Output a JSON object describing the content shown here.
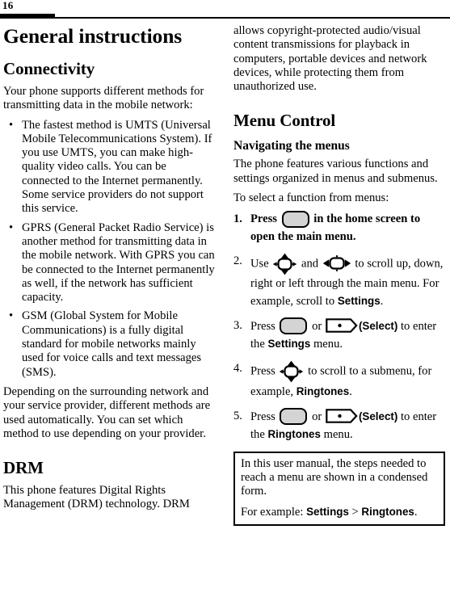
{
  "page": {
    "folio": "16"
  },
  "left_column": {
    "chapter_title": "General instructions",
    "connectivity": {
      "heading": "Connectivity",
      "intro": "Your phone supports different methods for transmitting data in the mobile network:",
      "bullets": [
        "The fastest method is UMTS (Universal Mobile Telecommunications System). If you use UMTS, you can make high-quality video calls. You can be connected to the Internet permanently. Some service providers do not support this service.",
        "GPRS (General Packet Radio Service) is another method for transmitting data in the mobile network. With GPRS you can be connected to the Internet permanently as well, if the network has sufficient capacity.",
        "GSM (Global System for Mobile Communications) is a fully digital standard for mobile networks mainly used for voice calls and text messages (SMS)."
      ],
      "closing": "Depending on the surrounding network and your service provider, different methods are used automatically. You can set which method to use depending on your provider."
    },
    "drm": {
      "heading": "DRM",
      "paragraph": "This phone features Digital Rights Management (DRM) technology. DRM"
    }
  },
  "right_column": {
    "drm_continued": "allows copyright-protected audio/visual content transmissions for playback in computers, portable devices and network devices, while protecting them from unauthorized use.",
    "menu_control": {
      "heading": "Menu Control",
      "subheading": "Navigating the menus",
      "paragraph1": "The phone features various functions and settings organized in menus and submenus.",
      "paragraph2": "To select a function from menus:",
      "steps": [
        {
          "number": "1.",
          "bold": true,
          "parts": [
            {
              "type": "text",
              "value": "Press "
            },
            {
              "type": "icon",
              "icon": "menu-key-icon"
            },
            {
              "type": "text",
              "value": " in the home screen to open the main menu."
            }
          ]
        },
        {
          "number": "2.",
          "bold": false,
          "parts": [
            {
              "type": "text",
              "value": "Use "
            },
            {
              "type": "icon",
              "icon": "nav-key-vertical-icon"
            },
            {
              "type": "text",
              "value": " and "
            },
            {
              "type": "icon",
              "icon": "nav-key-horizontal-icon"
            },
            {
              "type": "text",
              "value": "  to scroll up, down, right or left through the main menu. For example, scroll to "
            },
            {
              "type": "ui",
              "value": "Settings"
            },
            {
              "type": "text",
              "value": "."
            }
          ]
        },
        {
          "number": "3.",
          "bold": false,
          "parts": [
            {
              "type": "text",
              "value": "Press "
            },
            {
              "type": "icon",
              "icon": "menu-key-icon"
            },
            {
              "type": "text",
              "value": " or "
            },
            {
              "type": "icon",
              "icon": "soft-key-icon"
            },
            {
              "type": "ui",
              "value": "(Select)"
            },
            {
              "type": "text",
              "value": " to enter the "
            },
            {
              "type": "ui",
              "value": "Settings"
            },
            {
              "type": "text",
              "value": " menu."
            }
          ]
        },
        {
          "number": "4.",
          "bold": false,
          "parts": [
            {
              "type": "text",
              "value": "Press "
            },
            {
              "type": "icon",
              "icon": "nav-key-vertical-icon"
            },
            {
              "type": "text",
              "value": " to scroll to a submenu, for example, "
            },
            {
              "type": "ui",
              "value": "Ringtones"
            },
            {
              "type": "text",
              "value": "."
            }
          ]
        },
        {
          "number": "5.",
          "bold": false,
          "parts": [
            {
              "type": "text",
              "value": "Press "
            },
            {
              "type": "icon",
              "icon": "menu-key-icon"
            },
            {
              "type": "text",
              "value": " or "
            },
            {
              "type": "icon",
              "icon": "soft-key-icon"
            },
            {
              "type": "ui",
              "value": "(Select)"
            },
            {
              "type": "text",
              "value": " to enter the "
            },
            {
              "type": "ui",
              "value": "Ringtones"
            },
            {
              "type": "text",
              "value": " menu."
            }
          ]
        }
      ],
      "note_box": {
        "line1": "In this user manual, the steps needed to reach a menu are shown in a condensed form.",
        "example_prefix": "For example: ",
        "example_first": "Settings",
        "example_separator": " > ",
        "example_second": "Ringtones",
        "example_suffix": "."
      }
    }
  },
  "colors": {
    "text": "#000000",
    "background": "#ffffff",
    "key_fill": "#d4d4d4"
  }
}
